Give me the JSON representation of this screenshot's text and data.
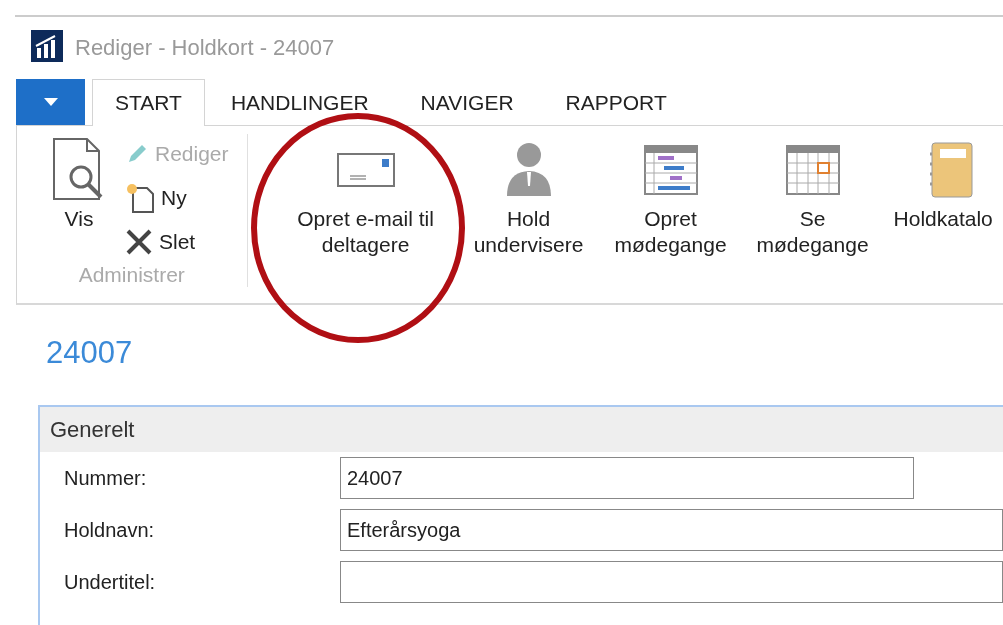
{
  "window": {
    "title": "Rediger - Holdkort - 24007"
  },
  "tabs": [
    {
      "label": "START",
      "selected": true
    },
    {
      "label": "HANDLINGER",
      "selected": false
    },
    {
      "label": "NAVIGER",
      "selected": false
    },
    {
      "label": "RAPPORT",
      "selected": false
    }
  ],
  "ribbon": {
    "groups": [
      {
        "label": "Administrer",
        "buttons": [
          {
            "kind": "large",
            "label": "Vis",
            "disabled": false
          },
          {
            "kind": "small",
            "label": "Rediger",
            "disabled": true
          },
          {
            "kind": "small",
            "label": "Ny",
            "disabled": false
          },
          {
            "kind": "small",
            "label": "Slet",
            "disabled": false
          }
        ]
      },
      {
        "buttons": [
          {
            "kind": "large",
            "label": "Opret e-mail til deltagere",
            "disabled": false
          },
          {
            "kind": "large",
            "label": "Hold undervisere",
            "disabled": false
          },
          {
            "kind": "large",
            "label": "Opret mødegange",
            "disabled": false
          },
          {
            "kind": "large",
            "label": "Se mødegange",
            "disabled": false
          },
          {
            "kind": "large",
            "label": "Holdkatalo",
            "disabled": false
          }
        ]
      }
    ]
  },
  "annotations": [
    {
      "kind": "circle"
    }
  ],
  "page_title": "24007",
  "section": {
    "title": "Generelt",
    "fields": [
      {
        "label": "Nummer:",
        "value": "24007"
      },
      {
        "label": "Holdnavn:",
        "value": "Efterårsyoga"
      },
      {
        "label": "Undertitel:"
      }
    ]
  }
}
